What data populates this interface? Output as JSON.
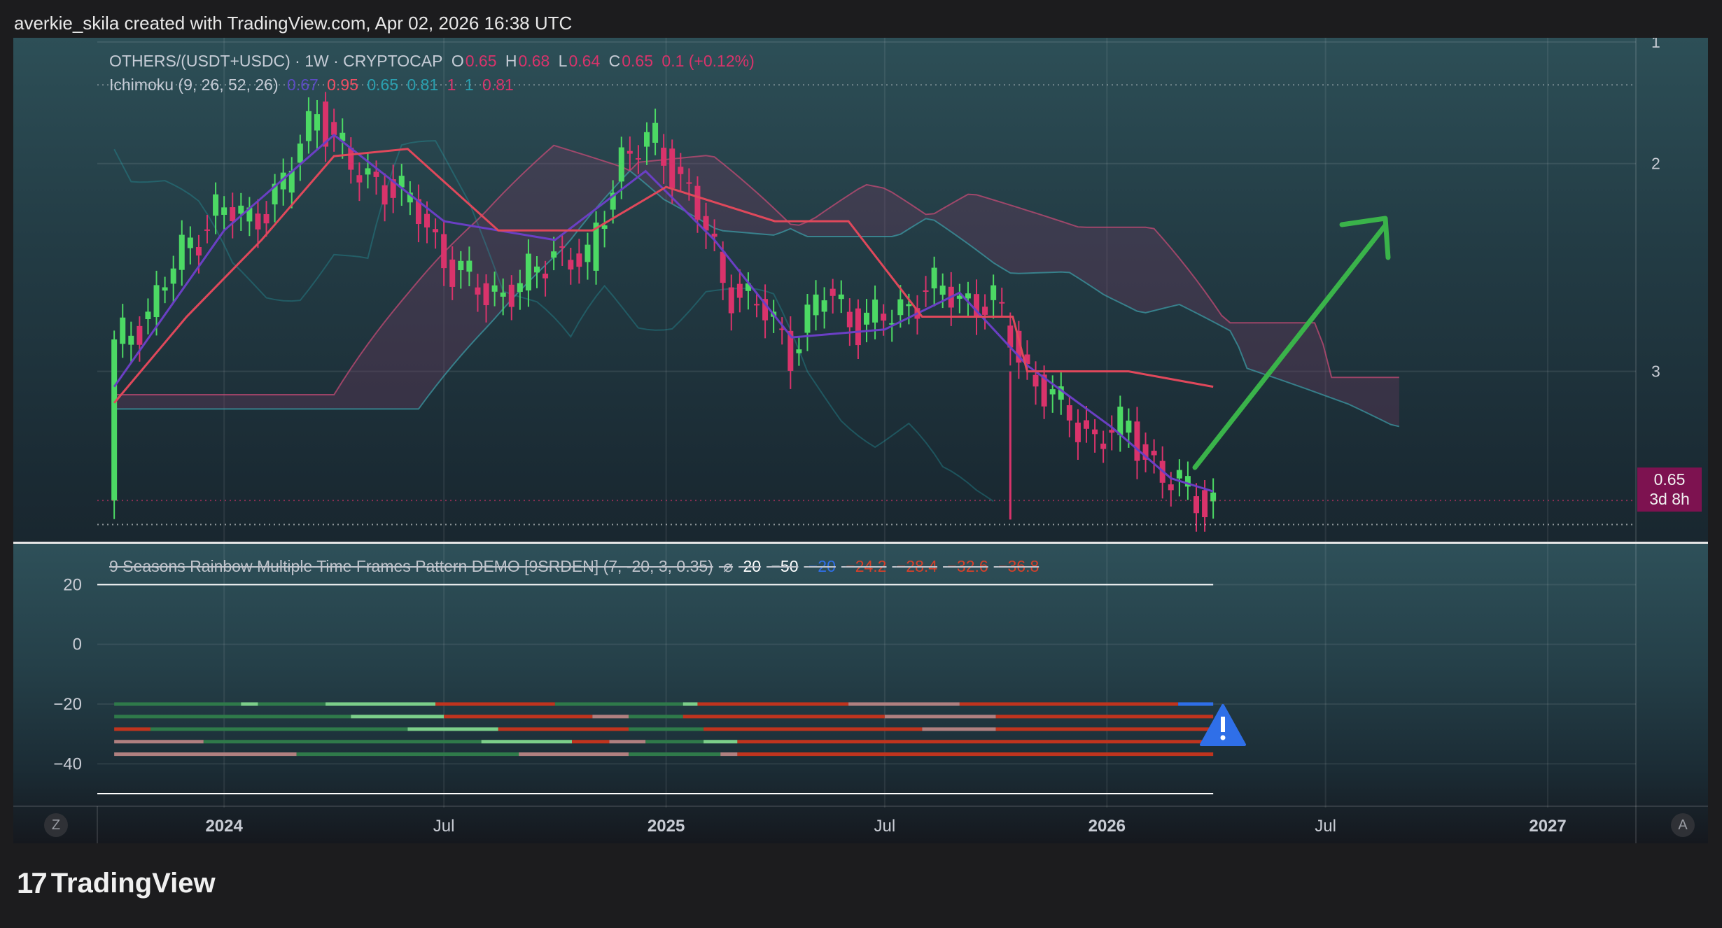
{
  "header": {
    "text": "averkie_skila created with TradingView.com, Apr 02, 2026 16:38 UTC"
  },
  "legend_main": {
    "symbol": "OTHERS/(USDT+USDC) · 1W · CRYPTOCAP",
    "o_label": "O",
    "o_value": "0.65",
    "h_label": "H",
    "h_value": "0.68",
    "l_label": "L",
    "l_value": "0.64",
    "c_label": "C",
    "c_value": "0.65",
    "change": "0.1 (+0.12%)"
  },
  "legend_ichimoku": {
    "name": "Ichimoku (9, 26, 52, 26)",
    "v1": "0.67",
    "v2": "0.95",
    "v3": "0.65",
    "v4": "0.81",
    "v5": "1",
    "v6": "1",
    "v7": "0.81"
  },
  "legend_indicator": {
    "name": "9 Seasons Rainbow Multiple Time Frames Pattern DEMO [9SRDEN] (7, -20, 3, 0.35)",
    "symbol": "⌀",
    "values": [
      "20",
      "−50",
      "−20",
      "−24.2",
      "−28.4",
      "−32.6",
      "−36.8"
    ]
  },
  "price_box": {
    "price": "0.65",
    "countdown": "3d 8h"
  },
  "right_axis_main": [
    "3",
    "2",
    "1"
  ],
  "right_axis_sub": [
    "20",
    "0",
    "−20",
    "−40"
  ],
  "time_axis": [
    "2024",
    "Jul",
    "2025",
    "Jul",
    "2026",
    "Jul",
    "2027"
  ],
  "corner_buttons": {
    "left": "Z",
    "right": "A"
  },
  "footer": {
    "brand": "TradingView",
    "mark": "17"
  },
  "colors": {
    "bull": "#4cd964",
    "bear": "#d9336b",
    "conversion": "#6a3fc4",
    "base": "#e0485b",
    "lagging": "#26a0a8",
    "cloud": "#6e3a5e",
    "arrow": "#3ab34a",
    "warning": "#2f6fe8"
  },
  "chart_data": [
    {
      "type": "candlestick",
      "title": "OTHERS/(USDT+USDC) · 1W · CRYPTOCAP",
      "y_scale": "log",
      "ylim": [
        0.58,
        3.0
      ],
      "y_ticks": [
        1,
        2,
        3
      ],
      "x_range": [
        "2023-09-18",
        "2027-03-15"
      ],
      "x_ticks": [
        "2024",
        "Jul",
        "2025",
        "Jul",
        "2026",
        "Jul",
        "2027"
      ],
      "last_price": 0.65,
      "close_series": [
        {
          "date": "2023-10-02",
          "close": 1.08
        },
        {
          "date": "2023-10-30",
          "close": 1.22
        },
        {
          "date": "2023-11-27",
          "close": 1.48
        },
        {
          "date": "2023-12-25",
          "close": 1.72
        },
        {
          "date": "2024-01-22",
          "close": 1.66
        },
        {
          "date": "2024-02-19",
          "close": 1.85
        },
        {
          "date": "2024-03-18",
          "close": 2.42
        },
        {
          "date": "2024-04-15",
          "close": 1.95
        },
        {
          "date": "2024-05-13",
          "close": 1.88
        },
        {
          "date": "2024-06-10",
          "close": 1.7
        },
        {
          "date": "2024-07-08",
          "close": 1.4
        },
        {
          "date": "2024-08-05",
          "close": 1.3
        },
        {
          "date": "2024-09-02",
          "close": 1.32
        },
        {
          "date": "2024-09-30",
          "close": 1.5
        },
        {
          "date": "2024-10-28",
          "close": 1.42
        },
        {
          "date": "2024-11-25",
          "close": 2.05
        },
        {
          "date": "2024-12-23",
          "close": 2.15
        },
        {
          "date": "2025-01-20",
          "close": 1.82
        },
        {
          "date": "2025-02-17",
          "close": 1.35
        },
        {
          "date": "2025-03-17",
          "close": 1.25
        },
        {
          "date": "2025-04-14",
          "close": 1.08
        },
        {
          "date": "2025-05-12",
          "close": 1.3
        },
        {
          "date": "2025-06-09",
          "close": 1.18
        },
        {
          "date": "2025-07-07",
          "close": 1.2
        },
        {
          "date": "2025-08-04",
          "close": 1.32
        },
        {
          "date": "2025-09-01",
          "close": 1.28
        },
        {
          "date": "2025-09-29",
          "close": 1.25
        },
        {
          "date": "2025-10-27",
          "close": 1.0
        },
        {
          "date": "2025-11-24",
          "close": 0.88
        },
        {
          "date": "2025-12-22",
          "close": 0.8
        },
        {
          "date": "2026-01-19",
          "close": 0.83
        },
        {
          "date": "2026-02-16",
          "close": 0.7
        },
        {
          "date": "2026-03-16",
          "close": 0.66
        },
        {
          "date": "2026-03-30",
          "close": 0.65
        }
      ],
      "ichimoku": {
        "params": [
          9,
          26,
          52,
          26
        ],
        "conversion": [
          {
            "date": "2023-10-02",
            "v": 0.95
          },
          {
            "date": "2024-01-01",
            "v": 1.6
          },
          {
            "date": "2024-04-01",
            "v": 2.2
          },
          {
            "date": "2024-07-01",
            "v": 1.65
          },
          {
            "date": "2024-10-01",
            "v": 1.55
          },
          {
            "date": "2024-12-15",
            "v": 1.95
          },
          {
            "date": "2025-02-10",
            "v": 1.55
          },
          {
            "date": "2025-04-15",
            "v": 1.12
          },
          {
            "date": "2025-07-01",
            "v": 1.15
          },
          {
            "date": "2025-09-01",
            "v": 1.3
          },
          {
            "date": "2025-10-27",
            "v": 1.02
          },
          {
            "date": "2026-01-05",
            "v": 0.83
          },
          {
            "date": "2026-02-23",
            "v": 0.7
          },
          {
            "date": "2026-03-30",
            "v": 0.67
          }
        ],
        "base": [
          {
            "date": "2023-10-02",
            "v": 0.9
          },
          {
            "date": "2023-12-01",
            "v": 1.2
          },
          {
            "date": "2024-02-01",
            "v": 1.55
          },
          {
            "date": "2024-04-01",
            "v": 2.05
          },
          {
            "date": "2024-06-01",
            "v": 2.1
          },
          {
            "date": "2024-08-15",
            "v": 1.6
          },
          {
            "date": "2024-11-01",
            "v": 1.6
          },
          {
            "date": "2025-01-01",
            "v": 1.85
          },
          {
            "date": "2025-04-01",
            "v": 1.65
          },
          {
            "date": "2025-06-01",
            "v": 1.65
          },
          {
            "date": "2025-08-01",
            "v": 1.2
          },
          {
            "date": "2025-10-15",
            "v": 1.2
          },
          {
            "date": "2025-10-27",
            "v": 1.0
          },
          {
            "date": "2026-01-19",
            "v": 1.0
          },
          {
            "date": "2026-03-30",
            "v": 0.95
          }
        ],
        "lagging_visible": true,
        "cloud_visible": true,
        "cloud_end_date": "2026-08-31"
      }
    },
    {
      "type": "heatmap",
      "title": "9 Seasons Rainbow Multiple Time Frames Pattern DEMO [9SRDEN] (7, -20, 3, 0.35)",
      "ylim": [
        -50,
        25
      ],
      "y_ticks": [
        20,
        0,
        -20,
        -40
      ],
      "lines": [
        {
          "level": 20,
          "color": "#ffffff"
        },
        {
          "level": -50,
          "color": "#ffffff"
        }
      ],
      "rows": [
        {
          "level": -20.0,
          "segments": [
            {
              "from": "2023-10-02",
              "to": "2024-01-15",
              "state": "bull"
            },
            {
              "from": "2024-01-15",
              "to": "2024-01-29",
              "state": "bull_light"
            },
            {
              "from": "2024-01-29",
              "to": "2024-03-25",
              "state": "bull"
            },
            {
              "from": "2024-03-25",
              "to": "2024-06-24",
              "state": "bull_light"
            },
            {
              "from": "2024-06-24",
              "to": "2024-10-01",
              "state": "bear"
            },
            {
              "from": "2024-10-01",
              "to": "2025-01-15",
              "state": "bull"
            },
            {
              "from": "2025-01-15",
              "to": "2025-01-27",
              "state": "bull_light"
            },
            {
              "from": "2025-01-27",
              "to": "2025-06-01",
              "state": "bear"
            },
            {
              "from": "2025-06-01",
              "to": "2025-09-01",
              "state": "neutral"
            },
            {
              "from": "2025-09-01",
              "to": "2026-03-01",
              "state": "bear"
            },
            {
              "from": "2026-03-01",
              "to": "2026-03-30",
              "state": "warning"
            }
          ]
        },
        {
          "level": -24.2,
          "segments": [
            {
              "from": "2023-10-02",
              "to": "2024-04-15",
              "state": "bull"
            },
            {
              "from": "2024-04-15",
              "to": "2024-07-01",
              "state": "bull_light"
            },
            {
              "from": "2024-07-01",
              "to": "2024-11-01",
              "state": "bear"
            },
            {
              "from": "2024-11-01",
              "to": "2024-12-01",
              "state": "neutral"
            },
            {
              "from": "2024-12-01",
              "to": "2025-01-15",
              "state": "bull"
            },
            {
              "from": "2025-01-15",
              "to": "2025-07-01",
              "state": "bear"
            },
            {
              "from": "2025-07-01",
              "to": "2025-10-01",
              "state": "neutral"
            },
            {
              "from": "2025-10-01",
              "to": "2026-03-30",
              "state": "bear"
            }
          ]
        },
        {
          "level": -28.4,
          "segments": [
            {
              "from": "2023-10-02",
              "to": "2023-11-01",
              "state": "bear"
            },
            {
              "from": "2023-11-01",
              "to": "2024-06-01",
              "state": "bull"
            },
            {
              "from": "2024-06-01",
              "to": "2024-08-15",
              "state": "bull_light"
            },
            {
              "from": "2024-08-15",
              "to": "2024-12-01",
              "state": "bear"
            },
            {
              "from": "2024-12-01",
              "to": "2025-02-01",
              "state": "bull"
            },
            {
              "from": "2025-02-01",
              "to": "2025-08-01",
              "state": "bear"
            },
            {
              "from": "2025-08-01",
              "to": "2025-10-01",
              "state": "neutral"
            },
            {
              "from": "2025-10-01",
              "to": "2026-03-30",
              "state": "bear"
            }
          ]
        },
        {
          "level": -32.6,
          "segments": [
            {
              "from": "2023-10-02",
              "to": "2023-12-15",
              "state": "neutral"
            },
            {
              "from": "2023-12-15",
              "to": "2024-08-01",
              "state": "bull"
            },
            {
              "from": "2024-08-01",
              "to": "2024-10-15",
              "state": "bull_light"
            },
            {
              "from": "2024-10-15",
              "to": "2024-11-15",
              "state": "bear"
            },
            {
              "from": "2024-11-15",
              "to": "2024-12-15",
              "state": "neutral"
            },
            {
              "from": "2024-12-15",
              "to": "2025-02-01",
              "state": "bull"
            },
            {
              "from": "2025-02-01",
              "to": "2025-03-01",
              "state": "bull_light"
            },
            {
              "from": "2025-03-01",
              "to": "2026-03-30",
              "state": "bear"
            }
          ]
        },
        {
          "level": -36.8,
          "segments": [
            {
              "from": "2023-10-02",
              "to": "2024-03-01",
              "state": "neutral"
            },
            {
              "from": "2024-03-01",
              "to": "2024-09-01",
              "state": "bull"
            },
            {
              "from": "2024-09-01",
              "to": "2024-12-01",
              "state": "neutral"
            },
            {
              "from": "2024-12-01",
              "to": "2025-02-15",
              "state": "bull"
            },
            {
              "from": "2025-02-15",
              "to": "2025-03-01",
              "state": "neutral"
            },
            {
              "from": "2025-03-01",
              "to": "2026-03-30",
              "state": "bear"
            }
          ]
        }
      ]
    }
  ]
}
